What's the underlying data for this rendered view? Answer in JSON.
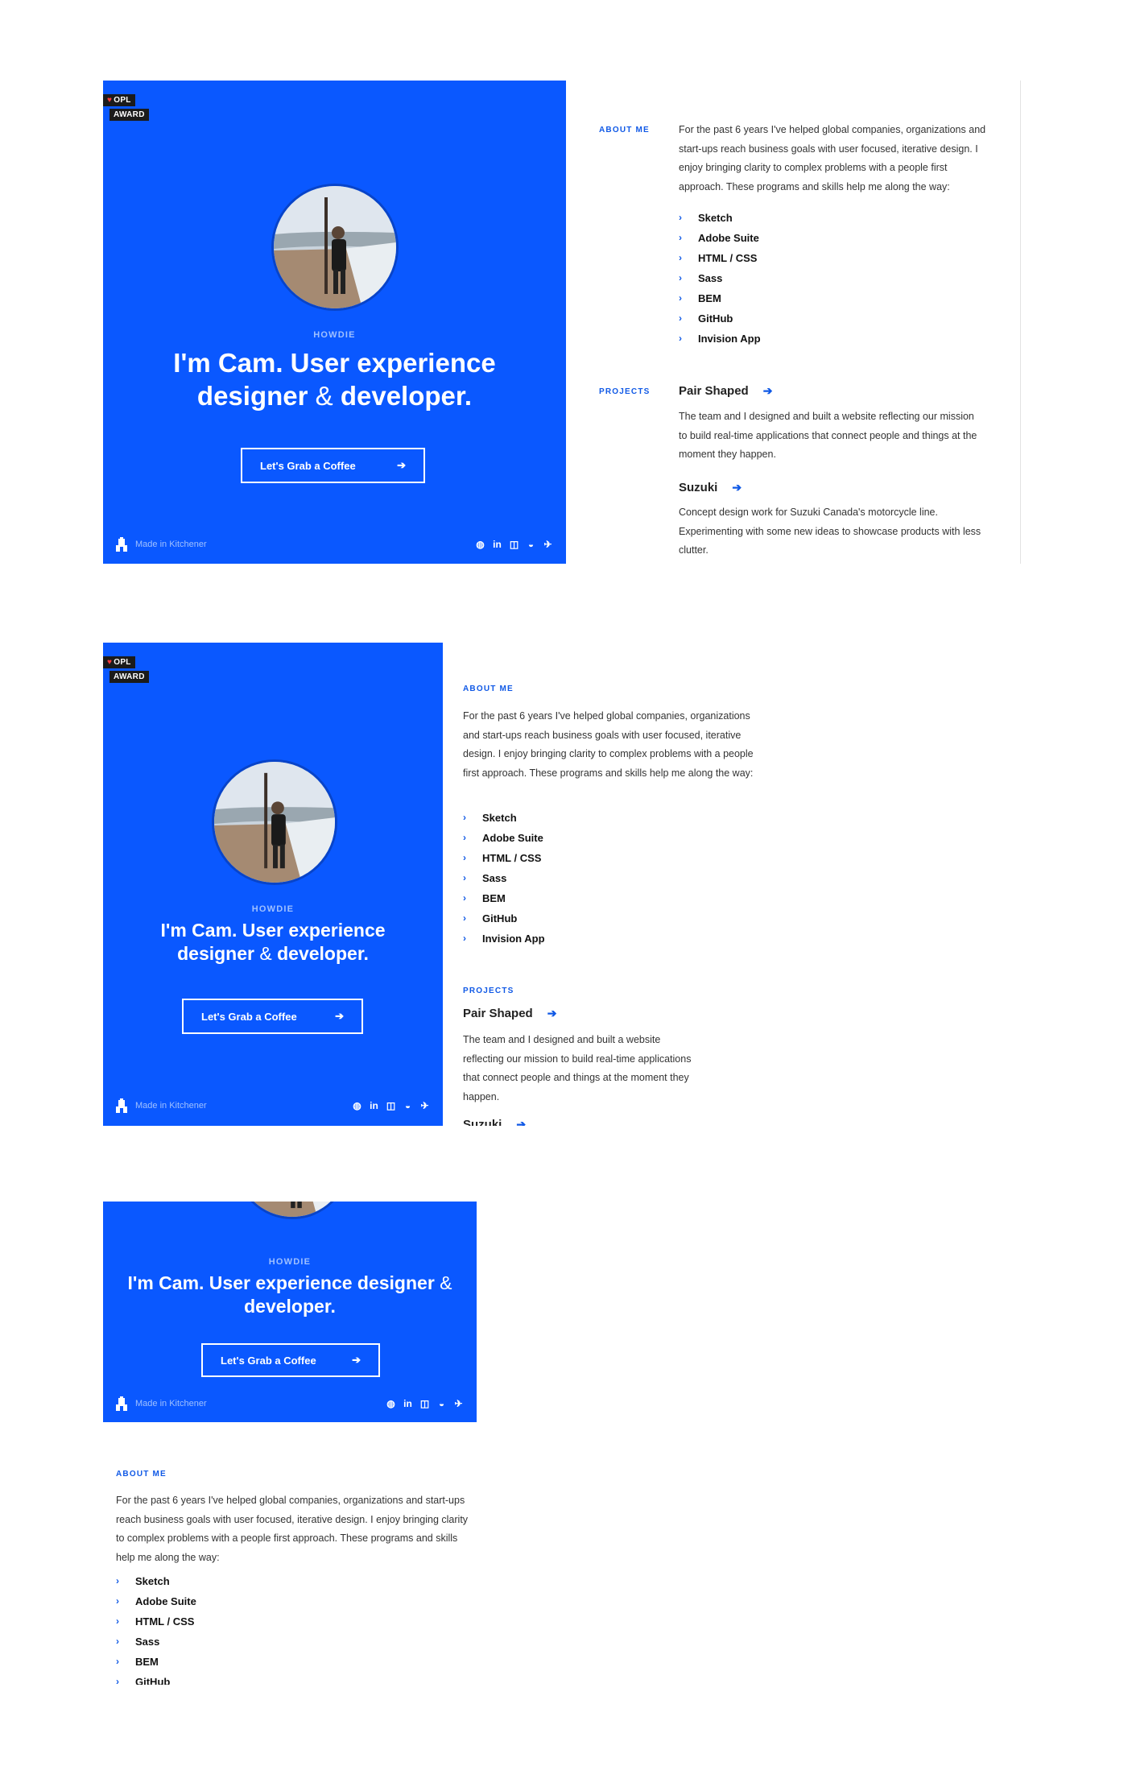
{
  "badge": {
    "line1": "OPL",
    "line2": "AWARD",
    "heart": "♥"
  },
  "hero": {
    "kicker": "HOWDIE",
    "headline_part1": "I'm Cam. User experience designer",
    "headline_amp": "&",
    "headline_part2": "developer.",
    "cta_label": "Let's Grab a Coffee",
    "cta_icon": "arrow-right-icon",
    "footer_text": "Made in Kitchener",
    "social_icons": [
      "dribbble-icon",
      "linkedin-icon",
      "instagram-icon",
      "github-icon",
      "twitter-icon"
    ],
    "social_glyphs": [
      "◍",
      "in",
      "◫",
      "◒",
      "✈"
    ]
  },
  "about": {
    "label": "ABOUT ME",
    "text": "For the past 6 years I've helped global companies, organizations and start-ups reach business goals with user focused, iterative design. I enjoy bringing clarity to complex problems with a people first approach. These programs and skills help me along the way:",
    "skills": [
      "Sketch",
      "Adobe Suite",
      "HTML / CSS",
      "Sass",
      "BEM",
      "GitHub",
      "Invision App"
    ]
  },
  "projects": {
    "label": "PROJECTS",
    "items": [
      {
        "title": "Pair Shaped",
        "text": "The team and I designed and built a website reflecting our mission to build real-time applications that connect people and things at the moment they happen."
      },
      {
        "title": "Suzuki",
        "text": "Concept design work for Suzuki Canada's motorcycle line. Experimenting with some new ideas to showcase products with less clutter."
      }
    ]
  },
  "colors": {
    "accent": "#0a58ff",
    "label_blue": "#1059e6"
  }
}
